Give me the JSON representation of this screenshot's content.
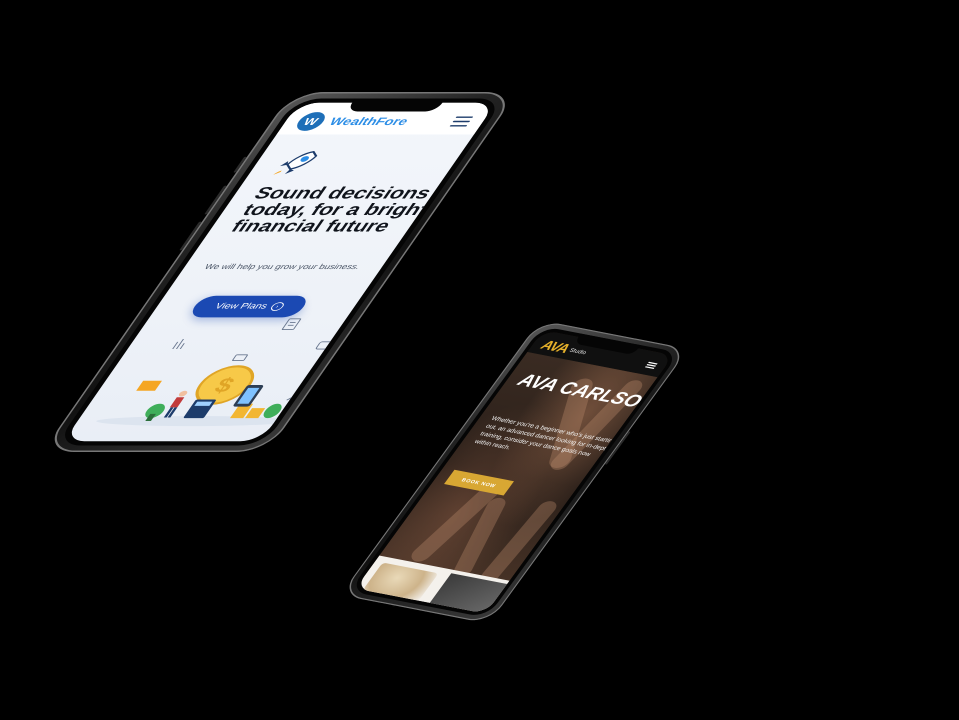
{
  "wealth_phone": {
    "brand": "WealthFore",
    "logo_mark": "W",
    "menu_icon": "hamburger-icon",
    "hero_icon": "rocket-icon",
    "headline": "Sound decisions today, for a bright financial future",
    "subtext": "We will help you grow your business.",
    "cta_label": "View Plans",
    "cta_icon": "arrow-circle-icon",
    "accent_color": "#1b49b3",
    "brand_color": "#2d8ee6"
  },
  "ava_phone": {
    "logo": "AVA",
    "logo_sub": "Studio",
    "menu_icon": "hamburger-icon",
    "title": "AVA CARLSON",
    "body": "Whether you're a beginner who's just starting out, an advanced dancer looking for in-depth training, consider your dance goals now within reach.",
    "cta_label": "BOOK NOW",
    "accent_color": "#d8a733"
  }
}
